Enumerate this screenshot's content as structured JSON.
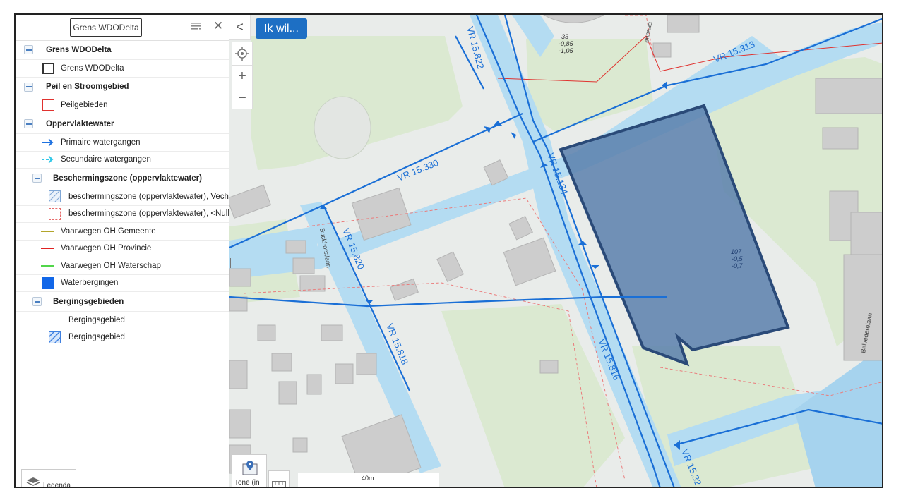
{
  "sidebar": {
    "search_value": "Grens WDODelta",
    "legend_tab_label": "Legenda"
  },
  "legend": {
    "grens": {
      "title": "Grens WDODelta",
      "items": [
        {
          "label": "Grens WDODelta",
          "stroke": "#333333"
        }
      ]
    },
    "peil": {
      "title": "Peil en Stroomgebied",
      "items": [
        {
          "label": "Peilgebieden",
          "stroke": "#e0322f"
        }
      ]
    },
    "opp": {
      "title": "Oppervlaktewater",
      "items": [
        {
          "label": "Primaire watergangen",
          "color": "#1f72e0"
        },
        {
          "label": "Secundaire watergangen",
          "color": "#32c8e8"
        }
      ]
    },
    "bescherming": {
      "title": "Beschermingszone (oppervlaktewater)",
      "items": [
        {
          "label": "beschermingszone (oppervlaktewater), Vecht"
        },
        {
          "label": "beschermingszone (oppervlaktewater), <Null>"
        }
      ]
    },
    "vaarwegen": [
      {
        "label": "Vaarwegen OH Gemeente",
        "color": "#b3a52b"
      },
      {
        "label": "Vaarwegen OH Provincie",
        "color": "#e02222"
      },
      {
        "label": "Vaarwegen OH Waterschap",
        "color": "#52d64a"
      }
    ],
    "waterbergingen": {
      "label": "Waterbergingen",
      "color": "#1267e8"
    },
    "berging": {
      "title": "Bergingsgebieden",
      "items": [
        {
          "label": "Bergingsgebied"
        },
        {
          "label": "Bergingsgebied"
        }
      ]
    }
  },
  "map": {
    "back_glyph": "<",
    "ikwil_label": "Ik wil...",
    "zoom_in": "+",
    "zoom_out": "−",
    "tool_label": "Tone (in",
    "scale_label": "40m",
    "watergangen": [
      "VR 15.822",
      "VR 15.313",
      "VR 15.330",
      "VR 15.134",
      "VR 15.820",
      "VR 15.818",
      "VR 15.816",
      "VR 15.32"
    ],
    "streets": [
      "Buckhorstlaan",
      "Belvederelaan",
      "ennaaa"
    ],
    "annot_north": [
      "33",
      "-0,85",
      "-1,05"
    ],
    "annot_basin": [
      "107",
      "-0,5",
      "-0,7"
    ],
    "colors": {
      "water": "#b4dcf2",
      "waterbody": "#a6d3ee",
      "green": "#dbe9d1",
      "building": "#cdcdcd",
      "basin": "#5a80ad",
      "basin_stroke": "#2a4a78",
      "watergang": "#1a6fd6"
    }
  }
}
